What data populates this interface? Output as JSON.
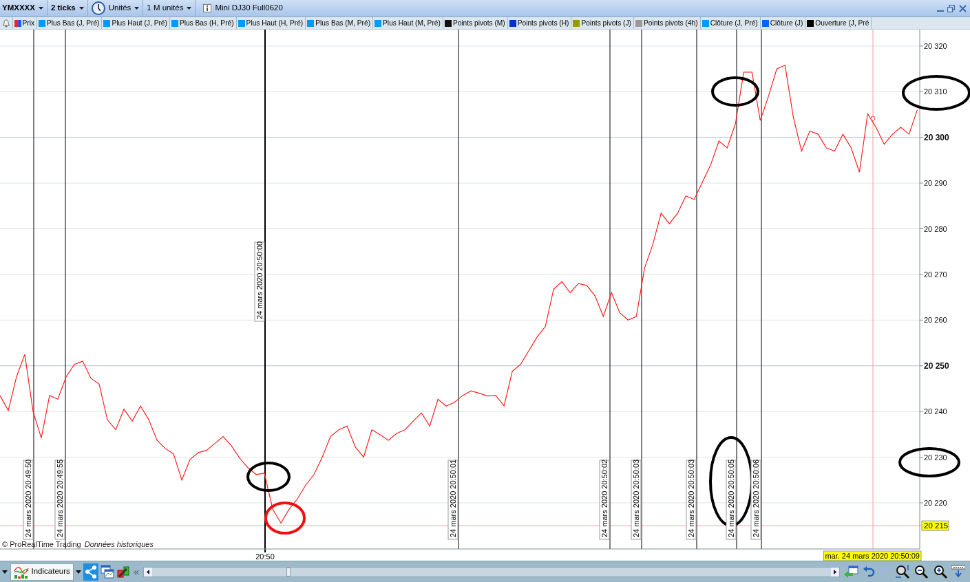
{
  "toolbar": [
    {
      "kind": "dropdown",
      "label": "YMXXXX",
      "bold": true
    },
    {
      "kind": "dropdown",
      "label": "2 ticks",
      "bold": true
    },
    {
      "kind": "clock",
      "label": "Unités",
      "bold": false
    },
    {
      "kind": "dropdown",
      "label": "1 M unités",
      "bold": false
    },
    {
      "kind": "info",
      "label": "Mini DJ30 Full0620",
      "bold": false
    }
  ],
  "legend": [
    {
      "label": "Prix",
      "swatches": [
        {
          "color": "#ff2020"
        },
        {
          "color": "#2255ff"
        }
      ]
    },
    {
      "label": "Plus Bas (J, Pré)",
      "color": "#0099ff"
    },
    {
      "label": "Plus Haut (J, Pré)",
      "color": "#0099ff"
    },
    {
      "label": "Plus Bas (H, Pré)",
      "color": "#0099ff"
    },
    {
      "label": "Plus Haut (H, Pré)",
      "color": "#0099ff"
    },
    {
      "label": "Plus Bas (M, Pré)",
      "color": "#0099ff"
    },
    {
      "label": "Plus Haut (M, Pré)",
      "color": "#0099ff"
    },
    {
      "label": "Points pivots (M)",
      "color": "#111111"
    },
    {
      "label": "Points pivots (H)",
      "color": "#0033cc"
    },
    {
      "label": "Points pivots (J)",
      "color": "#999900"
    },
    {
      "label": "Points pivots (4h)",
      "color": "#999999"
    },
    {
      "label": "Clôture (J, Pré)",
      "color": "#0099ff"
    },
    {
      "label": "Clôture (J)",
      "color": "#0066ff"
    },
    {
      "label": "Ouverture (J, Pré",
      "color": "#000000"
    }
  ],
  "chart": {
    "chart_data": {
      "type": "line",
      "grid": true,
      "ylim": [
        20209.9,
        20323.6
      ],
      "ref_lines": [
        {
          "axis": "y",
          "value": 20215,
          "label": "20 215"
        }
      ],
      "yticks": [
        {
          "value": 20220,
          "label": "20 220"
        },
        {
          "value": 20230,
          "label": "20 230"
        },
        {
          "value": 20240,
          "label": "20 240"
        },
        {
          "value": 20250,
          "label": "20 250"
        },
        {
          "value": 20260,
          "label": "20 260"
        },
        {
          "value": 20270,
          "label": "20 270"
        },
        {
          "value": 20280,
          "label": "20 280"
        },
        {
          "value": 20290,
          "label": "20 290"
        },
        {
          "value": 20300,
          "label": "20 300"
        },
        {
          "value": 20310,
          "label": "20 310"
        },
        {
          "value": 20320,
          "label": "20 320"
        }
      ],
      "series": [
        {
          "color": "#ff2020",
          "values": [
            20243.5,
            20240.2,
            20247.6,
            20252.5,
            20240,
            20234.2,
            20243.5,
            20242.7,
            20247.6,
            20250.3,
            20251,
            20247.3,
            20246,
            20238.2,
            20236,
            20240.5,
            20237.9,
            20241.2,
            20238.2,
            20233.7,
            20231.9,
            20230.7,
            20225,
            20229.5,
            20231,
            20231.5,
            20233,
            20234.5,
            20232.5,
            20229.8,
            20227.7,
            20226.2,
            20226.5,
            20218.6,
            20215.6,
            20218.6,
            20220.9,
            20223.9,
            20226.2,
            20230,
            20234.5,
            20236,
            20236.8,
            20232.2,
            20230,
            20236,
            20234.9,
            20233.7,
            20235.2,
            20236,
            20237.9,
            20239.7,
            20236.8,
            20242.7,
            20241.2,
            20242,
            20243.5,
            20244.5,
            20244,
            20243.4,
            20243.5,
            20241.2,
            20248.8,
            20250.3,
            20253.3,
            20256.3,
            20258.6,
            20266.8,
            20268.4,
            20266,
            20268,
            20267.6,
            20265.3,
            20260.8,
            20266,
            20261.6,
            20260,
            20260.8,
            20271.4,
            20276.6,
            20283.4,
            20281.1,
            20283.4,
            20287.2,
            20286.4,
            20290.2,
            20294,
            20299.2,
            20297.7,
            20303,
            20314.3,
            20314.3,
            20303.7,
            20309,
            20315,
            20315.8,
            20304.5,
            20297,
            20301.4,
            20300.7,
            20297.7,
            20297,
            20300.7,
            20297.7,
            20292.4,
            20305.2,
            20302.2,
            20298.5,
            20300.7,
            20302.2,
            20300.7,
            20306
          ]
        }
      ]
    },
    "x_axis_label": "20:50",
    "time_markers": [
      {
        "label": "24 mars 2020 20:49:50",
        "emphasis": false
      },
      {
        "label": "24 mars 2020 20:49:55",
        "emphasis": false
      },
      {
        "label": "24 mars 2020 20:50:00",
        "emphasis": true
      },
      {
        "label": "24 mars 2020 20:50:01",
        "emphasis": false
      },
      {
        "label": "24 mars 2020 20:50:02",
        "emphasis": false
      },
      {
        "label": "24 mars 2020 20:50:03",
        "emphasis": false
      },
      {
        "label": "24 mars 2020 20:50:03",
        "emphasis": false
      },
      {
        "label": "24 mars 2020 20:50:05",
        "emphasis": false
      },
      {
        "label": "24 mars 2020 20:50:06",
        "emphasis": false
      }
    ],
    "cursor": {
      "date_label": "mar. 24 mars 2020 20:50:09"
    },
    "copyright": "© ProRealTime Trading",
    "data_source": "Données historiques"
  },
  "bottom_toolbar": {
    "indicators_label": "Indicateurs",
    "collapse_glyph": "«"
  }
}
